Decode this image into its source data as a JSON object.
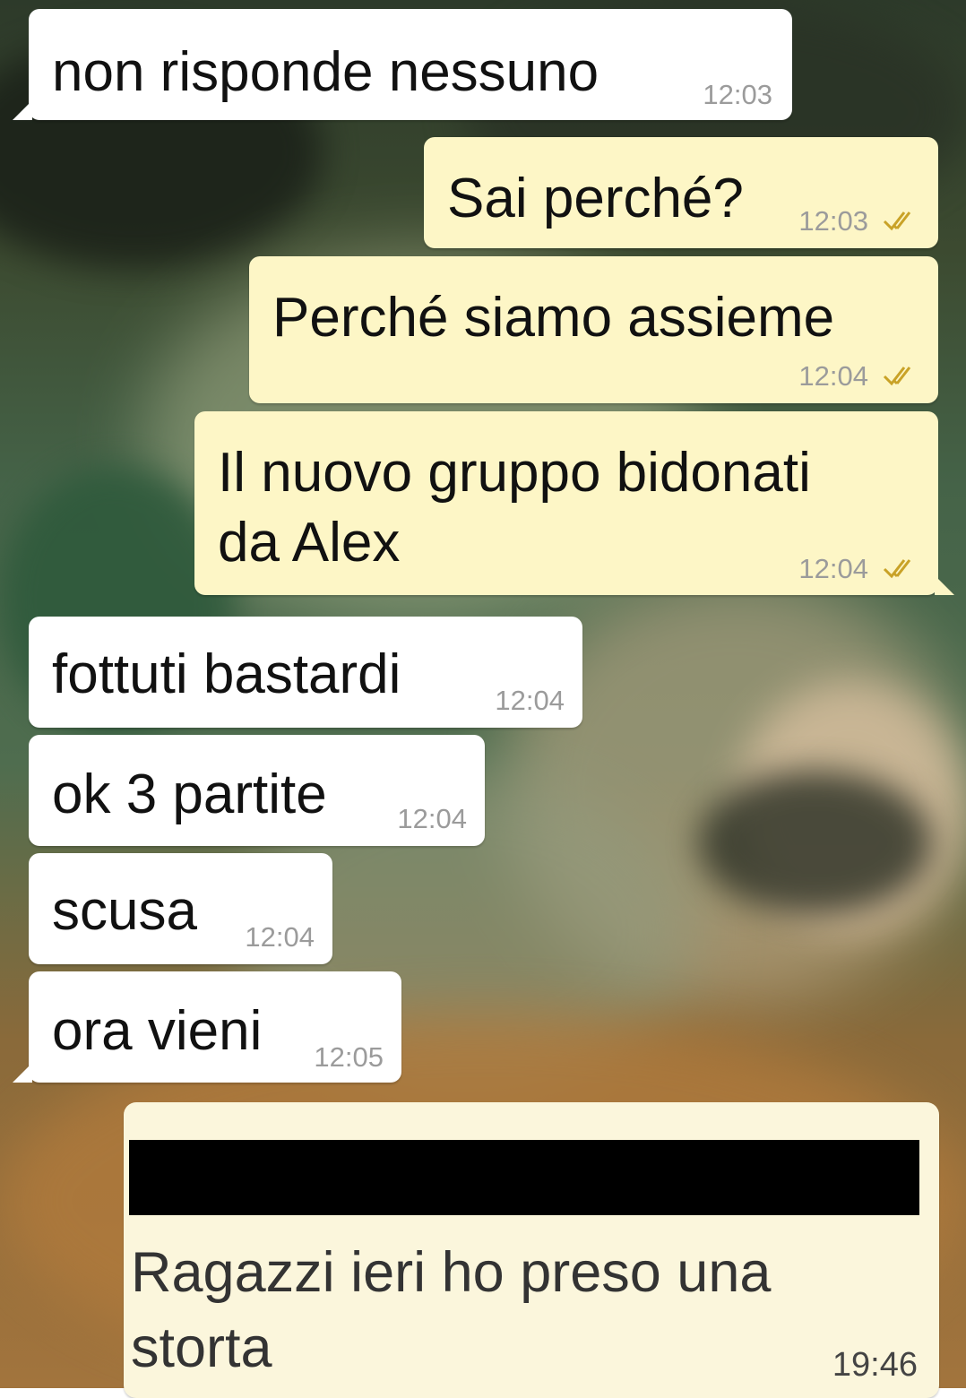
{
  "messages": [
    {
      "text": "non risponde nessuno",
      "time": "12:03",
      "direction": "incoming"
    },
    {
      "text": "Sai perché?",
      "time": "12:03",
      "direction": "outgoing",
      "status": "read"
    },
    {
      "text": "Perché siamo assieme",
      "time": "12:04",
      "direction": "outgoing",
      "status": "read"
    },
    {
      "text": "Il nuovo gruppo bidonati da Alex",
      "line1": "Il nuovo gruppo bidonati",
      "line2": "da Alex",
      "time": "12:04",
      "direction": "outgoing",
      "status": "read"
    },
    {
      "text": "fottuti bastardi",
      "time": "12:04",
      "direction": "incoming"
    },
    {
      "text": "ok 3 partite",
      "time": "12:04",
      "direction": "incoming"
    },
    {
      "text": "scusa",
      "time": "12:04",
      "direction": "incoming"
    },
    {
      "text": "ora vieni",
      "time": "12:05",
      "direction": "incoming"
    }
  ],
  "forwarded_screenshot": {
    "text": "Ragazzi ieri ho preso una storta",
    "time": "19:46"
  },
  "colors": {
    "incoming_bubble": "#ffffff",
    "outgoing_bubble": "#fdf6c6",
    "timestamp": "#9b9b9b",
    "read_ticks": "#c9a227"
  },
  "icons": {
    "read_receipt": "double-check-icon"
  }
}
